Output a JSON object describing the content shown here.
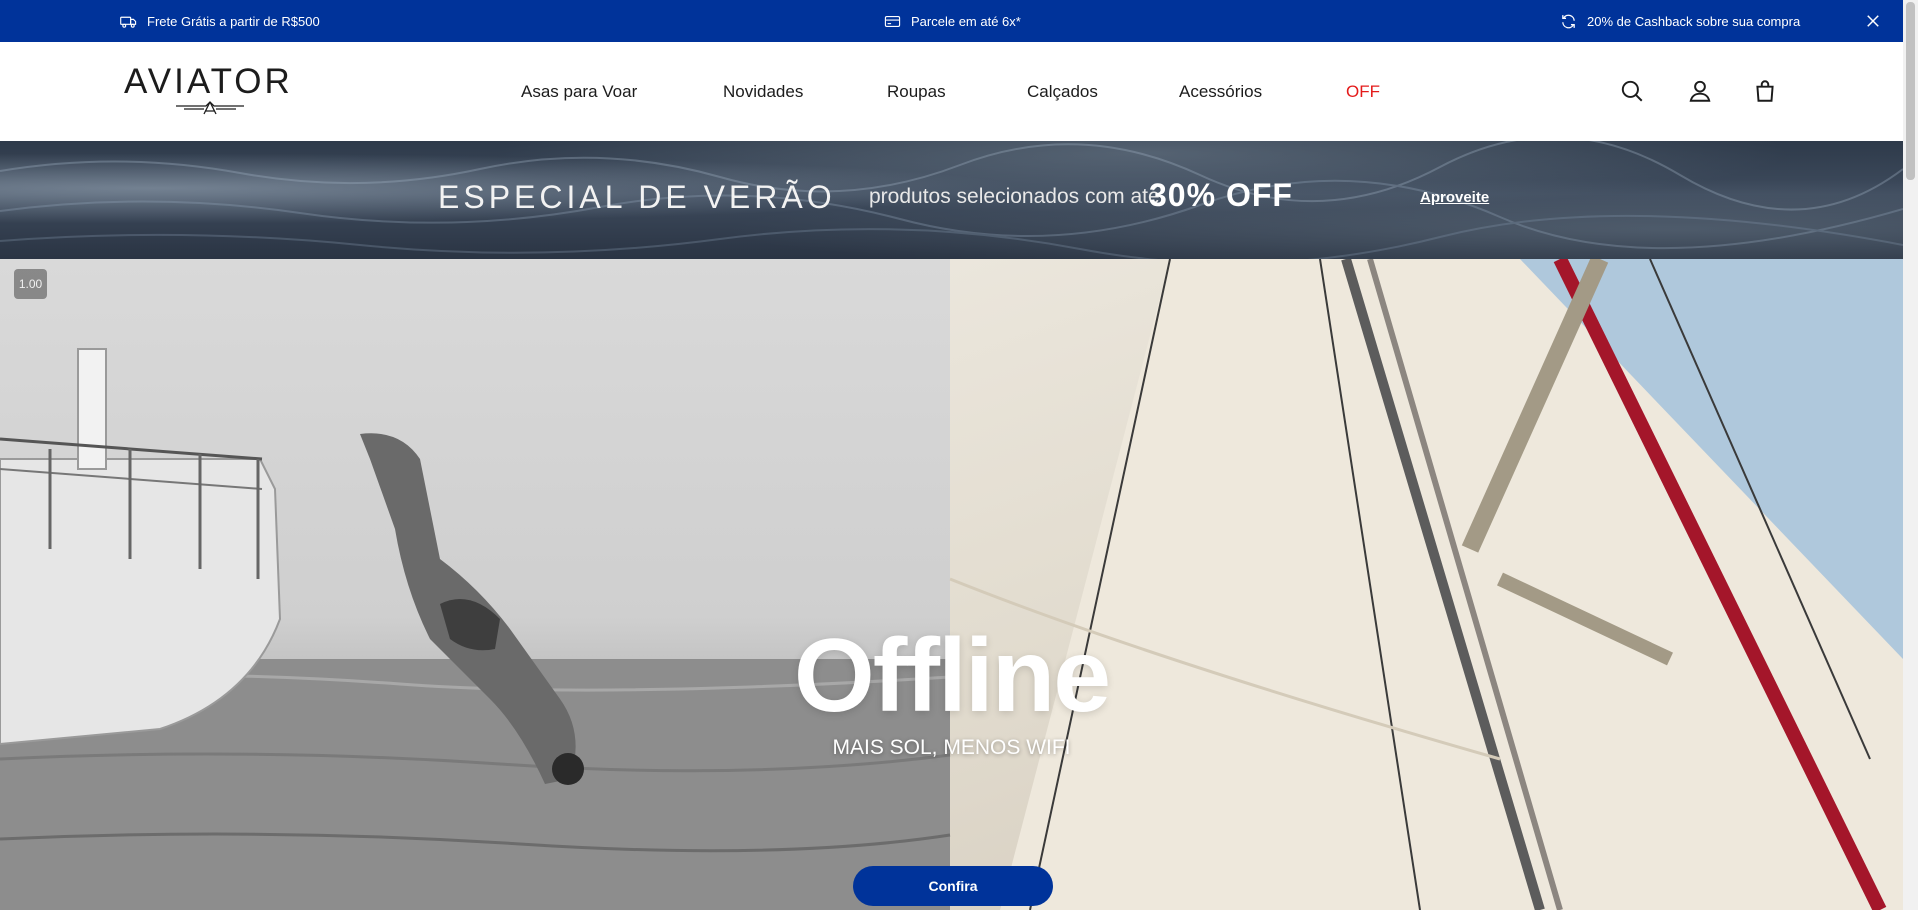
{
  "announcement_bar": {
    "items": [
      {
        "icon": "truck-icon",
        "text": "Frete Grátis a partir de R$500"
      },
      {
        "icon": "credit-card-icon",
        "text": "Parcele em até 6x*"
      },
      {
        "icon": "refresh-icon",
        "text": "20% de Cashback sobre sua compra"
      }
    ],
    "close_icon": "close-icon",
    "background": "#00339a"
  },
  "header": {
    "logo_text": "AVIATOR",
    "nav": [
      {
        "label": "Asas para Voar"
      },
      {
        "label": "Novidades"
      },
      {
        "label": "Roupas"
      },
      {
        "label": "Calçados"
      },
      {
        "label": "Acessórios"
      },
      {
        "label": "OFF",
        "color": "#e41b1b"
      }
    ],
    "icons": [
      "search-icon",
      "user-icon",
      "shopping-bag-icon"
    ]
  },
  "promo": {
    "title": "ESPECIAL DE VERÃO",
    "subtitle": "produtos selecionados com até",
    "highlight": "30% OFF",
    "cta": "Aproveite"
  },
  "hero": {
    "badge": "1.00",
    "headline": "Offline",
    "tagline": "MAIS SOL, MENOS WIFI",
    "cta": "Confira",
    "cta_color": "#00339a"
  }
}
